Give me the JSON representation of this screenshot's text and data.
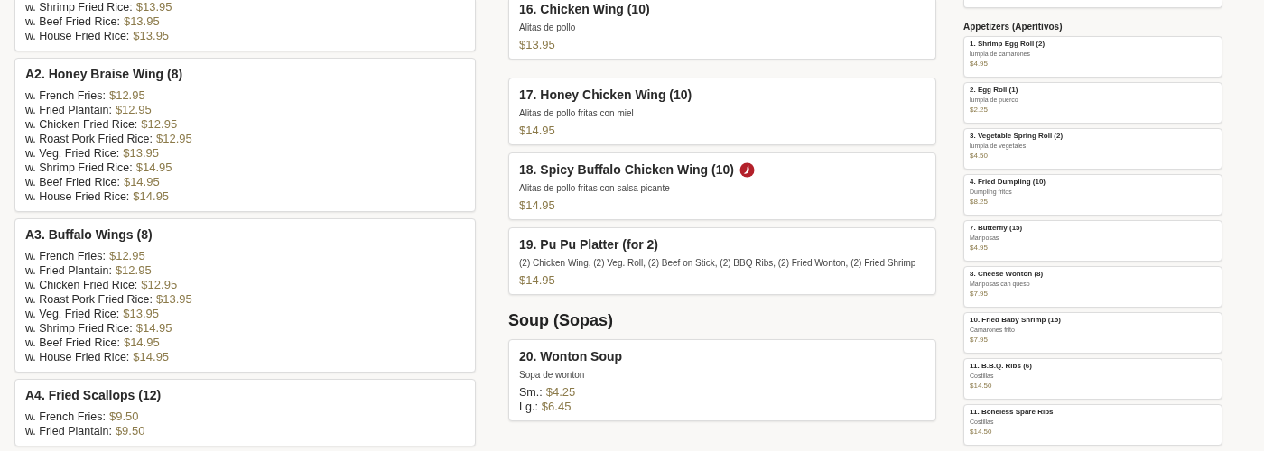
{
  "left_cards": [
    {
      "options": [
        {
          "label": "w. Shrimp Fried Rice:",
          "price": "$13.95"
        },
        {
          "label": "w. Beef Fried Rice:",
          "price": "$13.95"
        },
        {
          "label": "w. House Fried Rice:",
          "price": "$13.95"
        }
      ]
    },
    {
      "title": "A2. Honey Braise Wing (8)",
      "options": [
        {
          "label": "w. French Fries:",
          "price": "$12.95"
        },
        {
          "label": "w. Fried Plantain:",
          "price": "$12.95"
        },
        {
          "label": "w. Chicken Fried Rice:",
          "price": "$12.95"
        },
        {
          "label": "w. Roast Pork Fried Rice:",
          "price": "$12.95"
        },
        {
          "label": "w. Veg. Fried Rice:",
          "price": "$13.95"
        },
        {
          "label": "w. Shrimp Fried Rice:",
          "price": "$14.95"
        },
        {
          "label": "w. Beef Fried Rice:",
          "price": "$14.95"
        },
        {
          "label": "w. House Fried Rice:",
          "price": "$14.95"
        }
      ]
    },
    {
      "title": "A3. Buffalo Wings (8)",
      "options": [
        {
          "label": "w. French Fries:",
          "price": "$12.95"
        },
        {
          "label": "w. Fried Plantain:",
          "price": "$12.95"
        },
        {
          "label": "w. Chicken Fried Rice:",
          "price": "$12.95"
        },
        {
          "label": "w. Roast Pork Fried Rice:",
          "price": "$13.95"
        },
        {
          "label": "w. Veg. Fried Rice:",
          "price": "$13.95"
        },
        {
          "label": "w. Shrimp Fried Rice:",
          "price": "$14.95"
        },
        {
          "label": "w. Beef Fried Rice:",
          "price": "$14.95"
        },
        {
          "label": "w. House Fried Rice:",
          "price": "$14.95"
        }
      ]
    },
    {
      "title": "A4. Fried Scallops (12)",
      "options": [
        {
          "label": "w. French Fries:",
          "price": "$9.50"
        },
        {
          "label": "w. Fried Plantain:",
          "price": "$9.50"
        }
      ]
    }
  ],
  "middle": [
    {
      "kind": "dish",
      "title": "16. Chicken Wing (10)",
      "spicy": false,
      "description": "Alitas de pollo",
      "prices": [
        {
          "price": "$13.95"
        }
      ]
    },
    {
      "kind": "dish",
      "title": "17. Honey Chicken Wing (10)",
      "spicy": false,
      "description": "Alitas de pollo fritas con miel",
      "prices": [
        {
          "price": "$14.95"
        }
      ]
    },
    {
      "kind": "dish",
      "title": "18. Spicy Buffalo Chicken Wing (10)",
      "spicy": true,
      "description": "Alitas de pollo fritas con salsa picante",
      "prices": [
        {
          "price": "$14.95"
        }
      ]
    },
    {
      "kind": "dish",
      "title": "19. Pu Pu Platter (for 2)",
      "spicy": false,
      "description": "(2) Chicken Wing, (2) Veg. Roll, (2) Beef on Stick, (2) BBQ Ribs, (2) Fried Wonton, (2) Fried Shrimp",
      "prices": [
        {
          "price": "$14.95"
        }
      ]
    },
    {
      "kind": "heading",
      "title": "Soup (Sopas)"
    },
    {
      "kind": "dish",
      "title": "20. Wonton Soup",
      "spicy": false,
      "description": "Sopa de wonton",
      "prices": [
        {
          "label": "Sm.:",
          "price": "$4.25"
        },
        {
          "label": "Lg.:",
          "price": "$6.45"
        }
      ]
    }
  ],
  "right": {
    "heading": "Appetizers (Aperitivos)",
    "items": [
      {
        "title": "1. Shrimp Egg Roll (2)",
        "description": "lumpia de camarones",
        "price": "$4.95"
      },
      {
        "title": "2. Egg Roll (1)",
        "description": "lumpia de puerco",
        "price": "$2.25"
      },
      {
        "title": "3. Vegetable Spring Roll (2)",
        "description": "lumpia de vegetales",
        "price": "$4.50"
      },
      {
        "title": "4. Fried Dumpling (10)",
        "description": "Dumpling fritos",
        "price": "$8.25"
      },
      {
        "title": "7. Butterfly (15)",
        "description": "Mariposas",
        "price": "$4.95"
      },
      {
        "title": "8. Cheese Wonton (8)",
        "description": "Mariposas can queso",
        "price": "$7.95"
      },
      {
        "title": "10. Fried Baby Shrimp (15)",
        "description": "Camarones frito",
        "price": "$7.95"
      },
      {
        "title": "11. B.B.Q. Ribs (6)",
        "description": "Costillas",
        "price": "$14.50"
      },
      {
        "title": "11. Boneless Spare Ribs",
        "description": "Costillas",
        "price": "$14.50"
      }
    ]
  }
}
